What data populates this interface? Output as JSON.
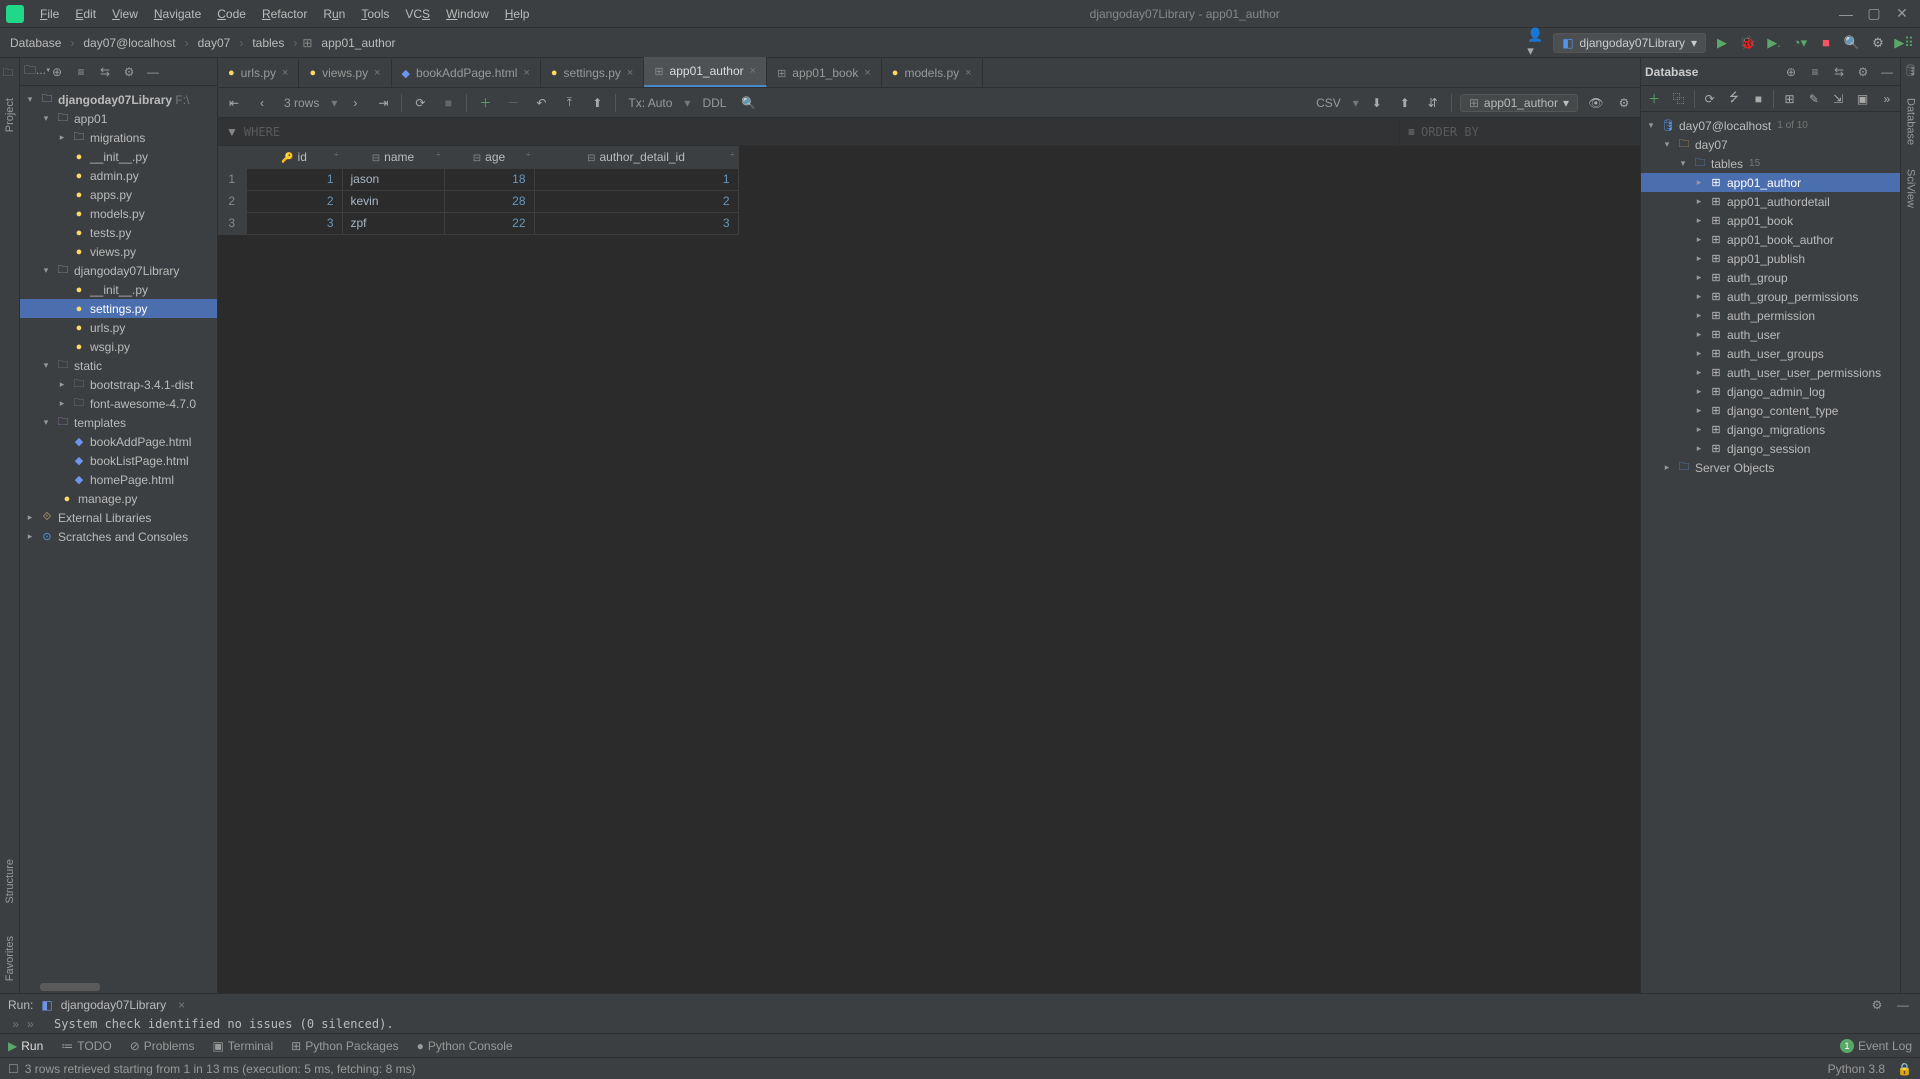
{
  "window_title": "djangoday07Library - app01_author",
  "menu": [
    "File",
    "Edit",
    "View",
    "Navigate",
    "Code",
    "Refactor",
    "Run",
    "Tools",
    "VCS",
    "Window",
    "Help"
  ],
  "breadcrumb": [
    "Database",
    "day07@localhost",
    "day07",
    "tables",
    "app01_author"
  ],
  "run_config": "djangoday07Library",
  "project": {
    "root": {
      "name": "djangoday07Library",
      "hint": "F:\\"
    },
    "app01": {
      "name": "app01",
      "children": [
        {
          "name": "migrations",
          "type": "folder"
        },
        {
          "name": "__init__.py",
          "type": "py"
        },
        {
          "name": "admin.py",
          "type": "py"
        },
        {
          "name": "apps.py",
          "type": "py"
        },
        {
          "name": "models.py",
          "type": "py"
        },
        {
          "name": "tests.py",
          "type": "py"
        },
        {
          "name": "views.py",
          "type": "py"
        }
      ]
    },
    "pkg": {
      "name": "djangoday07Library",
      "children": [
        {
          "name": "__init__.py",
          "type": "py"
        },
        {
          "name": "settings.py",
          "type": "py",
          "selected": true
        },
        {
          "name": "urls.py",
          "type": "py"
        },
        {
          "name": "wsgi.py",
          "type": "py"
        }
      ]
    },
    "static": {
      "name": "static",
      "children": [
        {
          "name": "bootstrap-3.4.1-dist",
          "type": "folder"
        },
        {
          "name": "font-awesome-4.7.0",
          "type": "folder"
        }
      ]
    },
    "templates": {
      "name": "templates",
      "children": [
        {
          "name": "bookAddPage.html",
          "type": "html"
        },
        {
          "name": "bookListPage.html",
          "type": "html"
        },
        {
          "name": "homePage.html",
          "type": "html"
        }
      ]
    },
    "manage": "manage.py",
    "ext": "External Libraries",
    "scratch": "Scratches and Consoles"
  },
  "tabs": [
    {
      "label": "urls.py",
      "icon": "py"
    },
    {
      "label": "views.py",
      "icon": "py"
    },
    {
      "label": "bookAddPage.html",
      "icon": "html"
    },
    {
      "label": "settings.py",
      "icon": "py"
    },
    {
      "label": "app01_author",
      "icon": "table",
      "active": true
    },
    {
      "label": "app01_book",
      "icon": "table"
    },
    {
      "label": "models.py",
      "icon": "py"
    }
  ],
  "db_toolbar": {
    "rows": "3 rows",
    "tx": "Tx: Auto",
    "ddl": "DDL",
    "csv": "CSV",
    "combo": "app01_author"
  },
  "filters": {
    "where": "WHERE",
    "order": "ORDER BY"
  },
  "columns": [
    "id",
    "name",
    "age",
    "author_detail_id"
  ],
  "rows": [
    {
      "n": 1,
      "id": 1,
      "name": "jason",
      "age": 18,
      "author_detail_id": 1
    },
    {
      "n": 2,
      "id": 2,
      "name": "kevin",
      "age": 28,
      "author_detail_id": 2
    },
    {
      "n": 3,
      "id": 3,
      "name": "zpf",
      "age": 22,
      "author_detail_id": 3
    }
  ],
  "db_panel": {
    "title": "Database",
    "ds": "day07@localhost",
    "ds_badge": "1 of 10",
    "schema": "day07",
    "tables_label": "tables",
    "tables_count": "15",
    "tables": [
      "app01_author",
      "app01_authordetail",
      "app01_book",
      "app01_book_author",
      "app01_publish",
      "auth_group",
      "auth_group_permissions",
      "auth_permission",
      "auth_user",
      "auth_user_groups",
      "auth_user_user_permissions",
      "django_admin_log",
      "django_content_type",
      "django_migrations",
      "django_session"
    ],
    "server_objects": "Server Objects"
  },
  "run_panel": {
    "label": "Run:",
    "config": "djangoday07Library",
    "output": "System check identified no issues (0 silenced)."
  },
  "bottom_tabs": [
    "Run",
    "TODO",
    "Problems",
    "Terminal",
    "Python Packages",
    "Python Console"
  ],
  "event_log": "Event Log",
  "status": {
    "msg": "3 rows retrieved starting from 1 in 13 ms (execution: 5 ms, fetching: 8 ms)",
    "python": "Python 3.8"
  },
  "gutters": {
    "left": [
      "Project",
      "Structure",
      "Favorites"
    ],
    "right": [
      "Database",
      "SciView"
    ]
  }
}
